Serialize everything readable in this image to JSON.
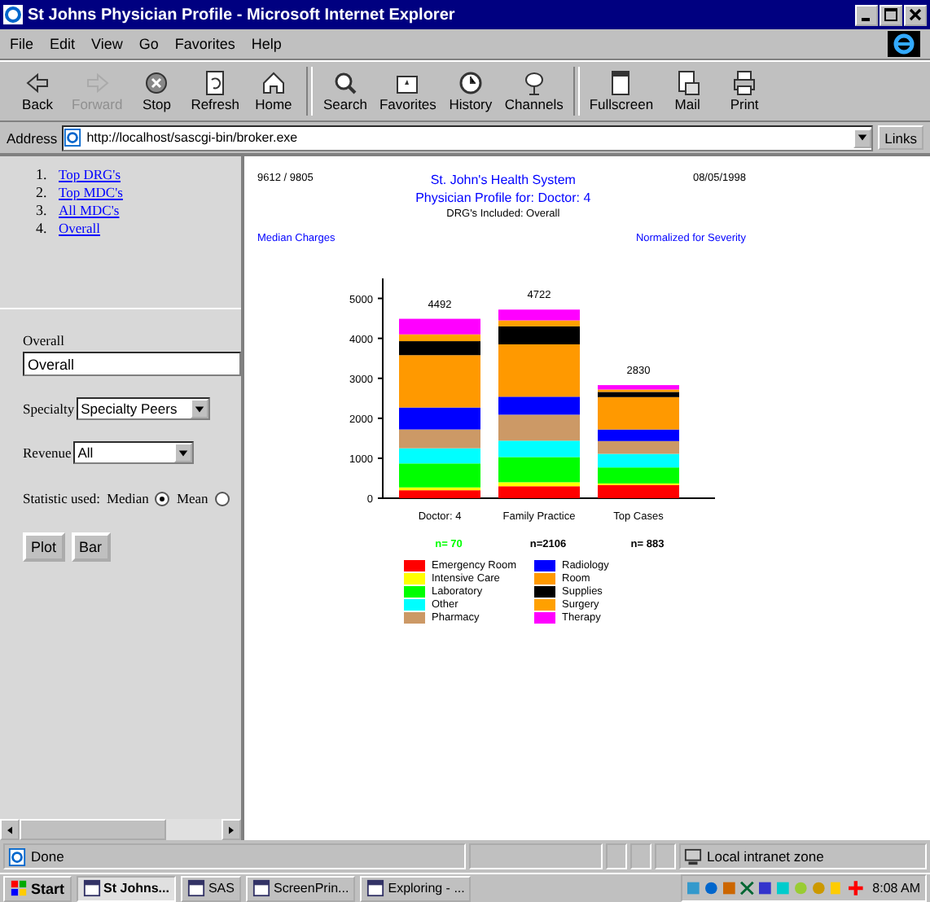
{
  "window": {
    "title": "St Johns Physician Profile - Microsoft Internet Explorer"
  },
  "menu": [
    "File",
    "Edit",
    "View",
    "Go",
    "Favorites",
    "Help"
  ],
  "toolbar": [
    {
      "label": "Back",
      "disabled": false
    },
    {
      "label": "Forward",
      "disabled": true
    },
    {
      "label": "Stop",
      "disabled": false
    },
    {
      "label": "Refresh",
      "disabled": false
    },
    {
      "label": "Home",
      "disabled": false
    },
    {
      "label": "Search",
      "disabled": false
    },
    {
      "label": "Favorites",
      "disabled": false
    },
    {
      "label": "History",
      "disabled": false
    },
    {
      "label": "Channels",
      "disabled": false
    },
    {
      "label": "Fullscreen",
      "disabled": false
    },
    {
      "label": "Mail",
      "disabled": false
    },
    {
      "label": "Print",
      "disabled": false
    }
  ],
  "address": {
    "label": "Address",
    "value": "http://localhost/sascgi-bin/broker.exe",
    "links": "Links"
  },
  "sidebar": {
    "links": [
      {
        "number": "1.",
        "label": "Top DRG's"
      },
      {
        "number": "2.",
        "label": "Top MDC's"
      },
      {
        "number": "3.",
        "label": "All MDC's"
      },
      {
        "number": "4.",
        "label": "Overall"
      }
    ],
    "overall_label": "Overall",
    "overall_value": "Overall",
    "specialty_label": "Specialty",
    "specialty_value": "Specialty Peers",
    "revenue_label": "Revenue",
    "revenue_value": "All",
    "statistic_label": "Statistic used:",
    "statistics": [
      {
        "label": "Median",
        "selected": true
      },
      {
        "label": "Mean",
        "selected": false
      }
    ],
    "buttons": [
      "Plot",
      "Bar"
    ]
  },
  "report": {
    "period": "9612 / 9805",
    "title": "St. John's Health System",
    "subtitle": "Physician Profile for: Doctor: 4",
    "date": "08/05/1998",
    "drgs": "DRG's Included: Overall",
    "left_note": "Median Charges",
    "right_note": "Normalized for Severity",
    "chart_data": {
      "type": "bar",
      "stacked": true,
      "categories": [
        "Doctor: 4",
        "Family Practice",
        "Top Cases"
      ],
      "ylim": [
        0,
        5500
      ],
      "yticks": [
        0,
        1000,
        2000,
        3000,
        4000,
        5000
      ],
      "value_labels": [
        "4492",
        "4722",
        "2830"
      ],
      "series": [
        {
          "name": "Emergency Room",
          "color": "#ff0000",
          "values": [
            200,
            300,
            330
          ]
        },
        {
          "name": "Intensive Care",
          "color": "#ffff00",
          "values": [
            70,
            100,
            40
          ]
        },
        {
          "name": "Laboratory",
          "color": "#00ff00",
          "values": [
            600,
            630,
            400
          ]
        },
        {
          "name": "Other",
          "color": "#00ffff",
          "values": [
            380,
            410,
            340
          ]
        },
        {
          "name": "Pharmacy",
          "color": "#cc9966",
          "values": [
            470,
            650,
            320
          ]
        },
        {
          "name": "Radiology",
          "color": "#0000ff",
          "values": [
            550,
            450,
            290
          ]
        },
        {
          "name": "Room",
          "color": "#ff9900",
          "values": [
            1310,
            1310,
            810
          ]
        },
        {
          "name": "Supplies",
          "color": "#000000",
          "values": [
            350,
            450,
            130
          ]
        },
        {
          "name": "Surgery",
          "color": "#ffa000",
          "values": [
            170,
            150,
            60
          ]
        },
        {
          "name": "Therapy",
          "color": "#ff00ff",
          "values": [
            390,
            270,
            110
          ]
        }
      ]
    },
    "counts": [
      {
        "text": "n= 70",
        "color": "#00ff00"
      },
      {
        "text": "n=2106",
        "color": "#000000"
      },
      {
        "text": "n= 883",
        "color": "#000000"
      }
    ]
  },
  "status_bar": {
    "text": "Done",
    "zone": "Local intranet zone"
  },
  "taskbar": {
    "start": "Start",
    "tasks": [
      {
        "label": "St Johns...",
        "selected": true
      },
      {
        "label": "SAS",
        "selected": false
      },
      {
        "label": "ScreenPrin...",
        "selected": false
      },
      {
        "label": "Exploring - ...",
        "selected": false
      }
    ],
    "time": "8:08 AM"
  }
}
